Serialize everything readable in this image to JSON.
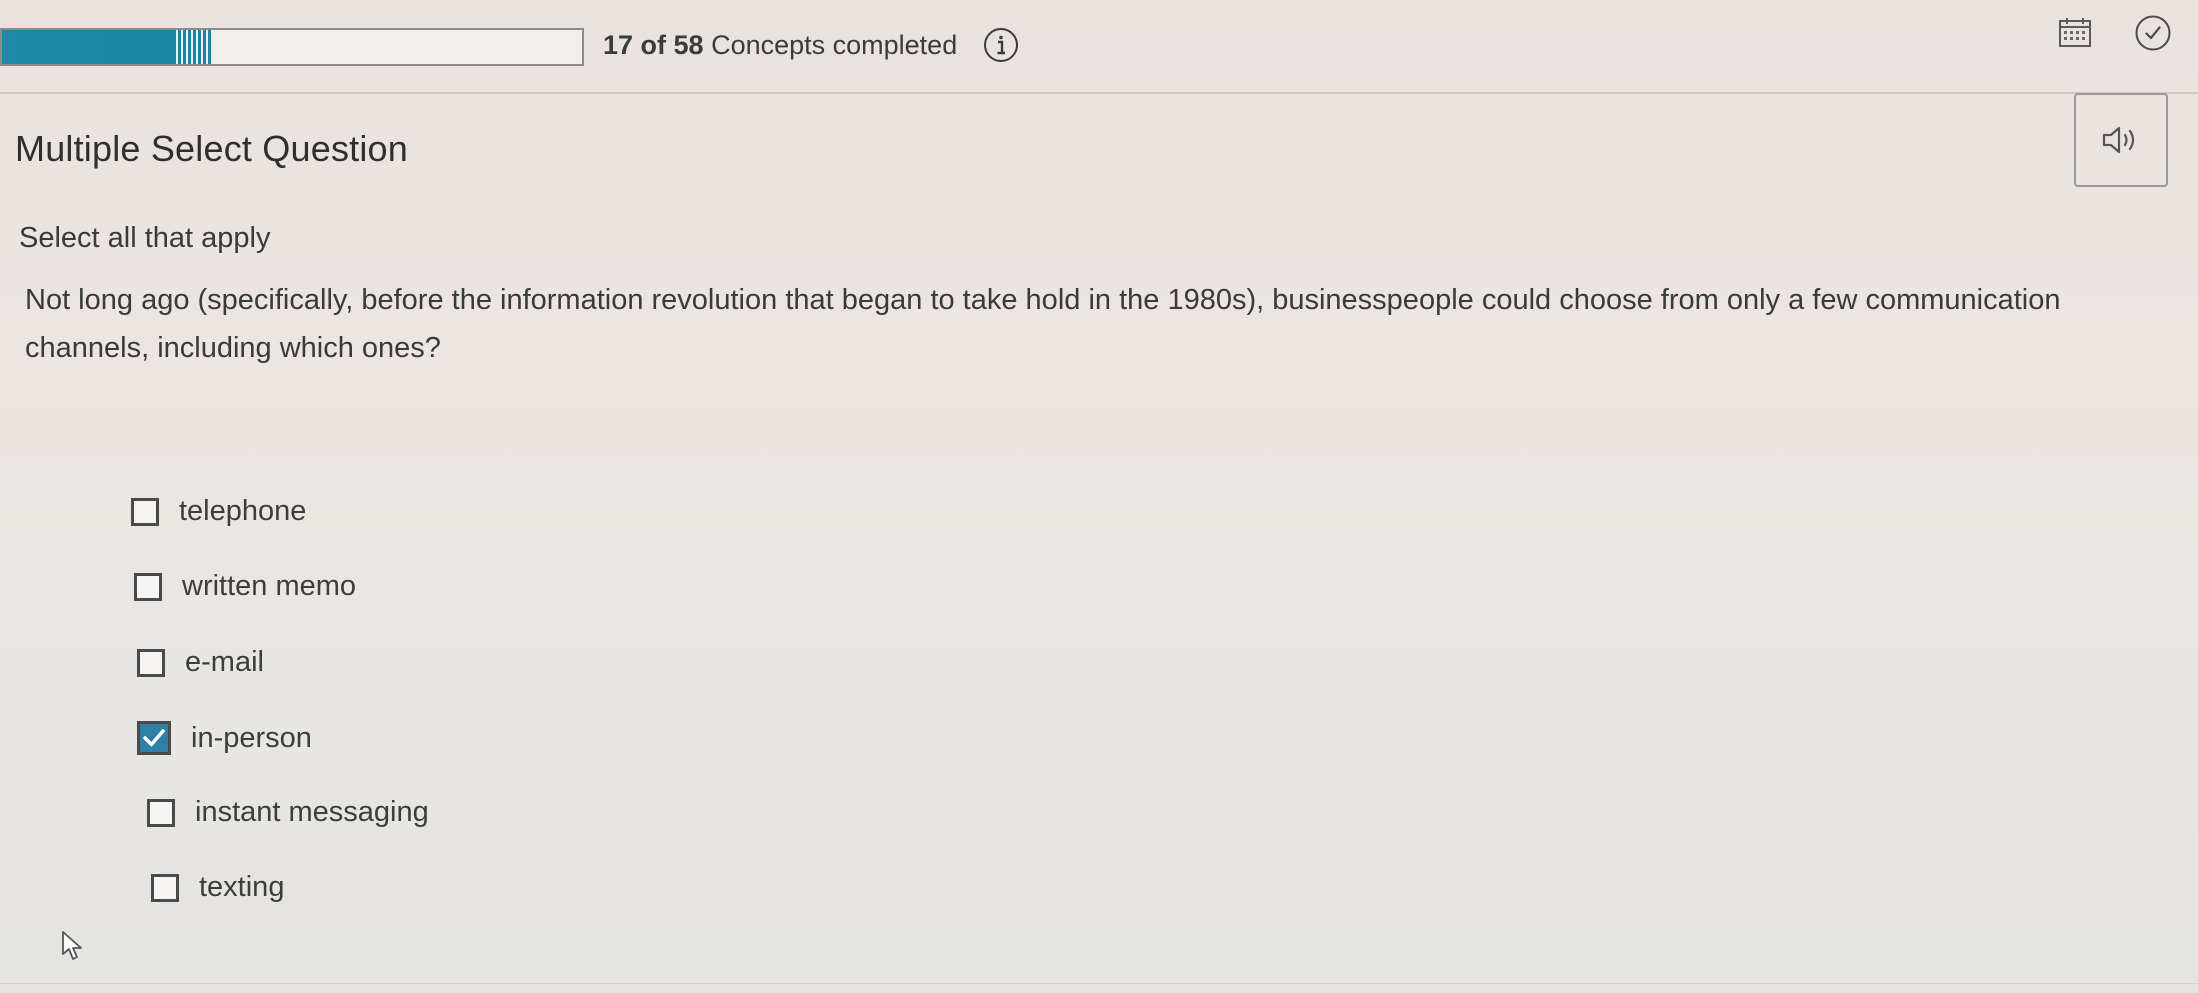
{
  "progress": {
    "completed": 17,
    "total": 58,
    "count_text": "17 of 58",
    "label": "Concepts completed",
    "fill_fraction": 0.36
  },
  "header": {
    "icons": [
      "info-icon",
      "calendar-icon",
      "check-circle-icon"
    ]
  },
  "question": {
    "type_label": "Multiple Select Question",
    "instruction": "Select all that apply",
    "prompt": "Not long ago (specifically, before the information revolution that began to take hold in the 1980s), businesspeople could choose from only a few communication channels, including which ones?",
    "audio_icon": "speaker-icon"
  },
  "choices": [
    {
      "label": "telephone",
      "checked": false
    },
    {
      "label": "written memo",
      "checked": false
    },
    {
      "label": "e-mail",
      "checked": false
    },
    {
      "label": "in-person",
      "checked": true
    },
    {
      "label": "instant messaging",
      "checked": false
    },
    {
      "label": "texting",
      "checked": false
    }
  ],
  "colors": {
    "accent": "#1c89a6",
    "checked_box": "#2d80a6"
  }
}
